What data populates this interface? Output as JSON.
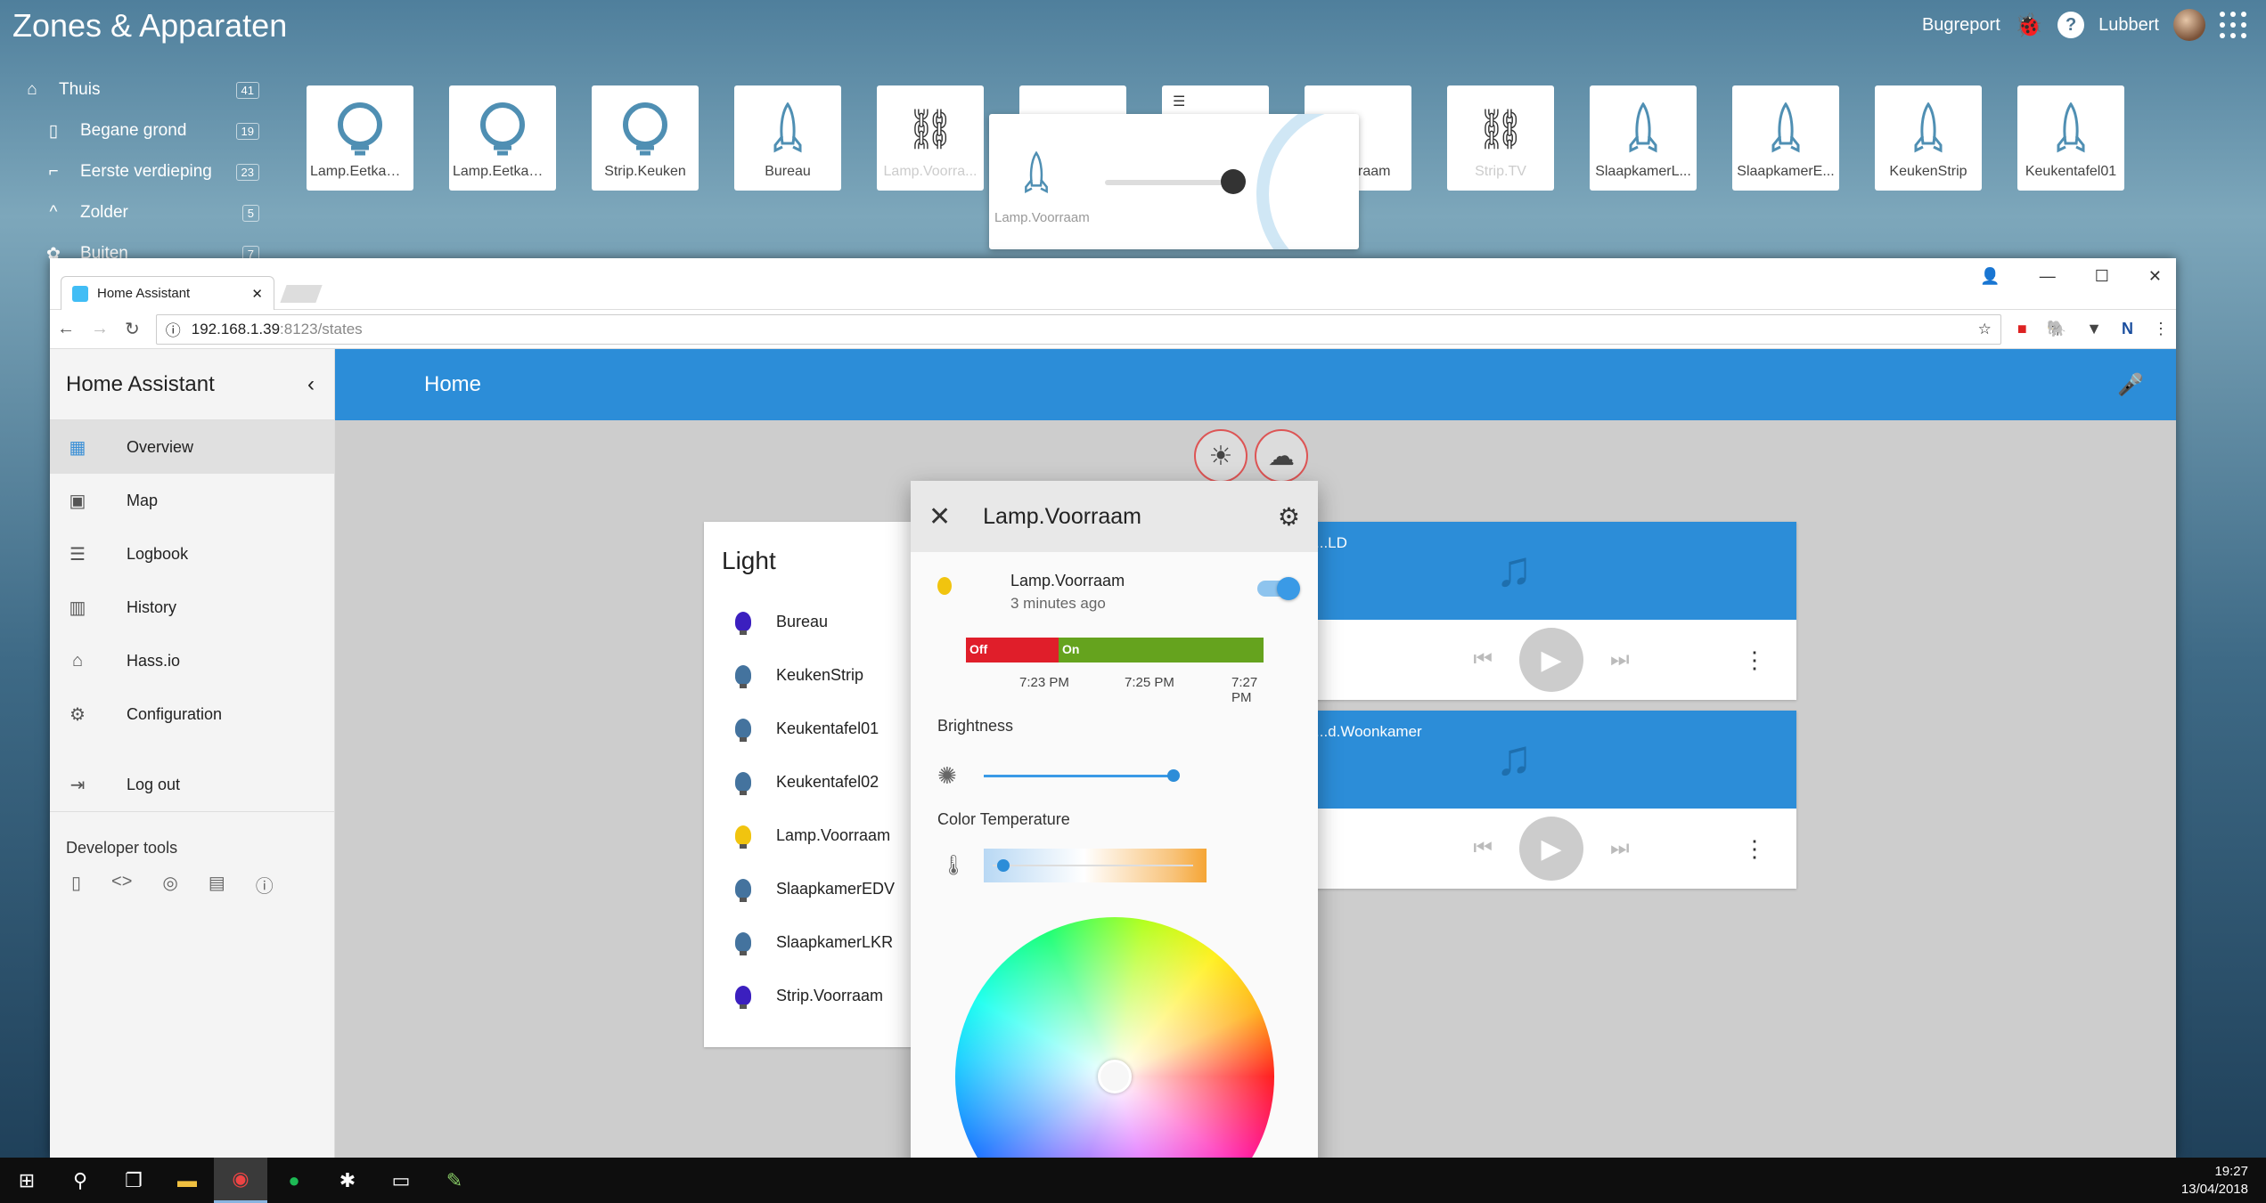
{
  "zones_app": {
    "title": "Zones & Apparaten",
    "bugreport": "Bugreport",
    "user": "Lubbert",
    "sidebar": [
      {
        "label": "Thuis",
        "count": "41"
      },
      {
        "label": "Begane grond",
        "count": "19"
      },
      {
        "label": "Eerste verdieping",
        "count": "23"
      },
      {
        "label": "Zolder",
        "count": "5"
      },
      {
        "label": "Buiten",
        "count": "7"
      }
    ],
    "tiles": [
      "Lamp.Eetkam...",
      "Lamp.Eetkam...",
      "Strip.Keuken",
      "Bureau",
      "Lamp.Voorra...",
      "",
      "",
      "...oorraam",
      "Strip.TV",
      "SlaapkamerL...",
      "SlaapkamerE...",
      "KeukenStrip",
      "Keukentafel01"
    ],
    "popup_label": "Lamp.Voorraam"
  },
  "browser": {
    "tab_title": "Home Assistant",
    "url_host": "192.168.1.39",
    "url_rest": ":8123/states"
  },
  "ha": {
    "sidebar_title": "Home Assistant",
    "nav": [
      "Overview",
      "Map",
      "Logbook",
      "History",
      "Hass.io",
      "Configuration"
    ],
    "logout": "Log out",
    "dev_tools": "Developer tools",
    "page_title": "Home",
    "light_card": {
      "title": "Light",
      "items": [
        {
          "name": "Bureau",
          "color": "#3b1fbf"
        },
        {
          "name": "KeukenStrip",
          "color": "#44739e"
        },
        {
          "name": "Keukentafel01",
          "color": "#44739e"
        },
        {
          "name": "Keukentafel02",
          "color": "#44739e"
        },
        {
          "name": "Lamp.Voorraam",
          "color": "#f1c40f"
        },
        {
          "name": "SlaapkamerEDV",
          "color": "#44739e"
        },
        {
          "name": "SlaapkamerLKR",
          "color": "#44739e"
        },
        {
          "name": "Strip.Voorraam",
          "color": "#3b1fbf"
        }
      ]
    },
    "media1_title": "...LD",
    "media2_title": "...d.Woonkamer"
  },
  "dialog": {
    "title": "Lamp.Voorraam",
    "entity_name": "Lamp.Voorraam",
    "last_changed": "3 minutes ago",
    "state_off": "Off",
    "state_on": "On",
    "ticks": [
      "7:23 PM",
      "7:25 PM",
      "7:27 PM"
    ],
    "brightness_label": "Brightness",
    "brightness_value": 0.97,
    "color_temp_label": "Color Temperature",
    "color_temp_value": 0.02
  },
  "taskbar": {
    "time": "19:27",
    "date": "13/04/2018"
  }
}
